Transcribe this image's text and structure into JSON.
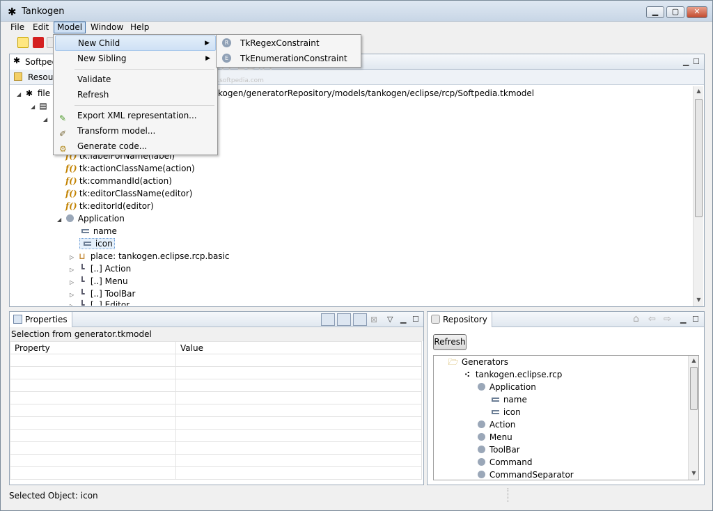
{
  "window": {
    "title": "Tankogen",
    "minimize": "▁",
    "maximize": "▢",
    "close": "✕"
  },
  "menubar": [
    "File",
    "Edit",
    "Model",
    "Window",
    "Help"
  ],
  "editor": {
    "tab_label": "Softpedia",
    "resource_tab": "Resource",
    "path_prefix": "file",
    "path_text": "kogen/generatorRepository/models/tankogen/eclipse/rcp/Softpedia.tkmodel",
    "tree": [
      "tk:labelForName(label)",
      "tk:actionClassName(action)",
      "tk:commandId(action)",
      "tk:editorClassName(editor)",
      "tk:editorId(editor)",
      "Application",
      "name",
      "icon",
      "place: tankogen.eclipse.rcp.basic",
      "[..] Action",
      "[..] Menu",
      "[..] ToolBar",
      "[..] Editor"
    ]
  },
  "model_menu": {
    "items": [
      "New Child",
      "New Sibling",
      "Validate",
      "Refresh",
      "Export XML representation...",
      "Transform model...",
      "Generate code..."
    ]
  },
  "submenu": {
    "items": [
      "TkRegexConstraint",
      "TkEnumerationConstraint"
    ]
  },
  "watermark": {
    "text": "SOFTPEDIA",
    "url": "www.softpedia.com"
  },
  "properties": {
    "tab_label": "Properties",
    "selection": "Selection from generator.tkmodel",
    "col_property": "Property",
    "col_value": "Value"
  },
  "repository": {
    "tab_label": "Repository",
    "refresh_button": "Refresh",
    "tree": [
      "Generators",
      "tankogen.eclipse.rcp",
      "Application",
      "name",
      "icon",
      "Action",
      "Menu",
      "ToolBar",
      "Command",
      "CommandSeparator"
    ]
  },
  "status": {
    "text": "Selected Object: icon"
  }
}
